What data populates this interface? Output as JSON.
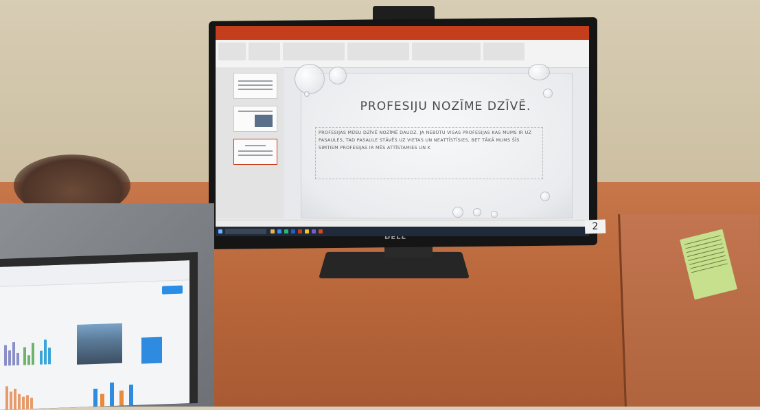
{
  "slide": {
    "title": "PROFESIJU NOZĪME DZĪVĒ.",
    "body": "PROFESIJAS MŪSU DZĪVĒ NOZĪMĒ DAUDZ. JA NEBŪTU VISAS PROFESIJAS KAS MUMS IR UZ PASAULES, TAD PASAULE STĀVĒS UZ VIETAS UN NEATTĪSTĪSIES, BET TĀKĀ MUMS ŠĪS SIMTIEM PROFESIJAS IR MĒS ATTĪSTAMIES UN K"
  },
  "monitor": {
    "brand": "DELL"
  },
  "desk": {
    "card_number": "2"
  },
  "colors": {
    "powerpoint_accent": "#c43e1c",
    "taskbar": "#1f2a3a",
    "desk_wood": "#b8663a"
  }
}
